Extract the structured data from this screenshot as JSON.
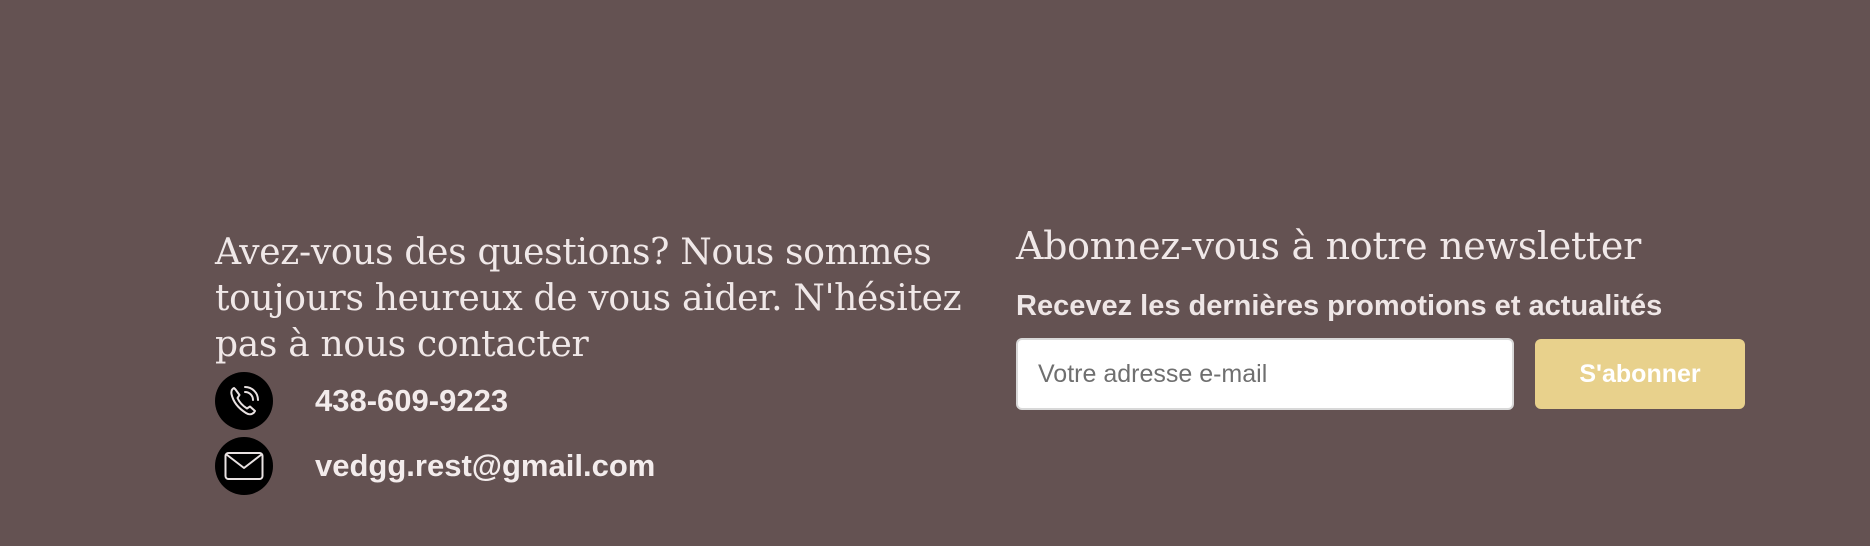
{
  "contact": {
    "question": "Avez-vous des questions? Nous sommes toujours heureux de vous aider. N'hésitez pas à nous contacter",
    "phone": "438-609-9223",
    "email": "vedgg.rest@gmail.com",
    "phone_icon": "phone-icon",
    "email_icon": "envelope-icon"
  },
  "newsletter": {
    "title": "Abonnez-vous à notre newsletter",
    "subtitle": "Recevez les dernières promotions et actualités",
    "email_placeholder": "Votre adresse e-mail",
    "email_value": "",
    "subscribe_label": "S'abonner"
  },
  "colors": {
    "background": "#645252",
    "button": "#e8d18c",
    "icon_circle": "#000000"
  }
}
